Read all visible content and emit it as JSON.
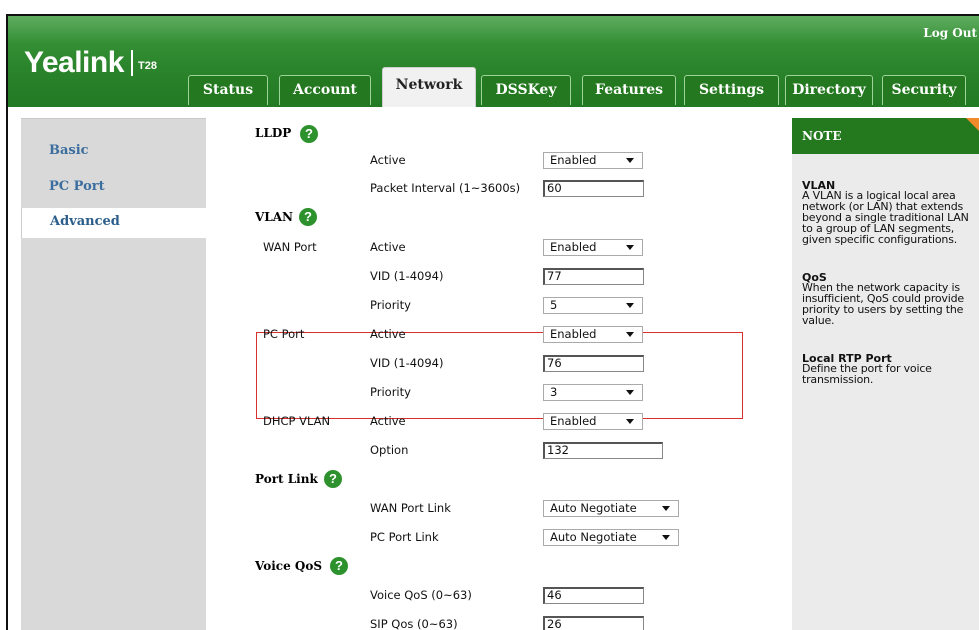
{
  "header": {
    "logo": "Yealink",
    "model": "T28",
    "logout": "Log Out",
    "tabs": [
      {
        "label": "Status",
        "active": false
      },
      {
        "label": "Account",
        "active": false
      },
      {
        "label": "Network",
        "active": true
      },
      {
        "label": "DSSKey",
        "active": false
      },
      {
        "label": "Features",
        "active": false
      },
      {
        "label": "Settings",
        "active": false
      },
      {
        "label": "Directory",
        "active": false
      },
      {
        "label": "Security",
        "active": false
      }
    ]
  },
  "sidebar": {
    "items": [
      {
        "label": "Basic",
        "active": false
      },
      {
        "label": "PC Port",
        "active": false
      },
      {
        "label": "Advanced",
        "active": true
      }
    ]
  },
  "help_glyph": "?",
  "lldp": {
    "title": "LLDP",
    "active_label": "Active",
    "active_value": "Enabled",
    "interval_label": "Packet Interval (1~3600s)",
    "interval_value": "60"
  },
  "vlan": {
    "title": "VLAN",
    "wan": {
      "group": "WAN Port",
      "active_label": "Active",
      "active_value": "Enabled",
      "vid_label": "VID (1-4094)",
      "vid_value": "77",
      "priority_label": "Priority",
      "priority_value": "5"
    },
    "pc": {
      "group": "PC Port",
      "active_label": "Active",
      "active_value": "Enabled",
      "vid_label": "VID (1-4094)",
      "vid_value": "76",
      "priority_label": "Priority",
      "priority_value": "3"
    },
    "dhcp": {
      "group": "DHCP VLAN",
      "active_label": "Active",
      "active_value": "Enabled",
      "option_label": "Option",
      "option_value": "132"
    }
  },
  "port_link": {
    "title": "Port Link",
    "wan_label": "WAN Port Link",
    "wan_value": "Auto Negotiate",
    "pc_label": "PC Port Link",
    "pc_value": "Auto Negotiate"
  },
  "voice_qos": {
    "title": "Voice QoS",
    "voice_label": "Voice QoS (0~63)",
    "voice_value": "46",
    "sip_label": "SIP Qos (0~63)",
    "sip_value": "26"
  },
  "note": {
    "header": "NOTE",
    "items": [
      {
        "title": "VLAN",
        "text": "A VLAN is a logical local area network (or LAN) that extends beyond a single traditional LAN to a group of LAN segments, given specific configurations."
      },
      {
        "title": "QoS",
        "text": "When the network capacity is insufficient, QoS could provide priority to users by setting the value."
      },
      {
        "title": "Local RTP Port",
        "text": "Define the port for voice transmission."
      }
    ]
  },
  "colors": {
    "header_green": "#2b852c",
    "note_corner": "#f08a2a",
    "highlight_border": "#d9302c",
    "sidebar_link": "#3b6e9e"
  }
}
